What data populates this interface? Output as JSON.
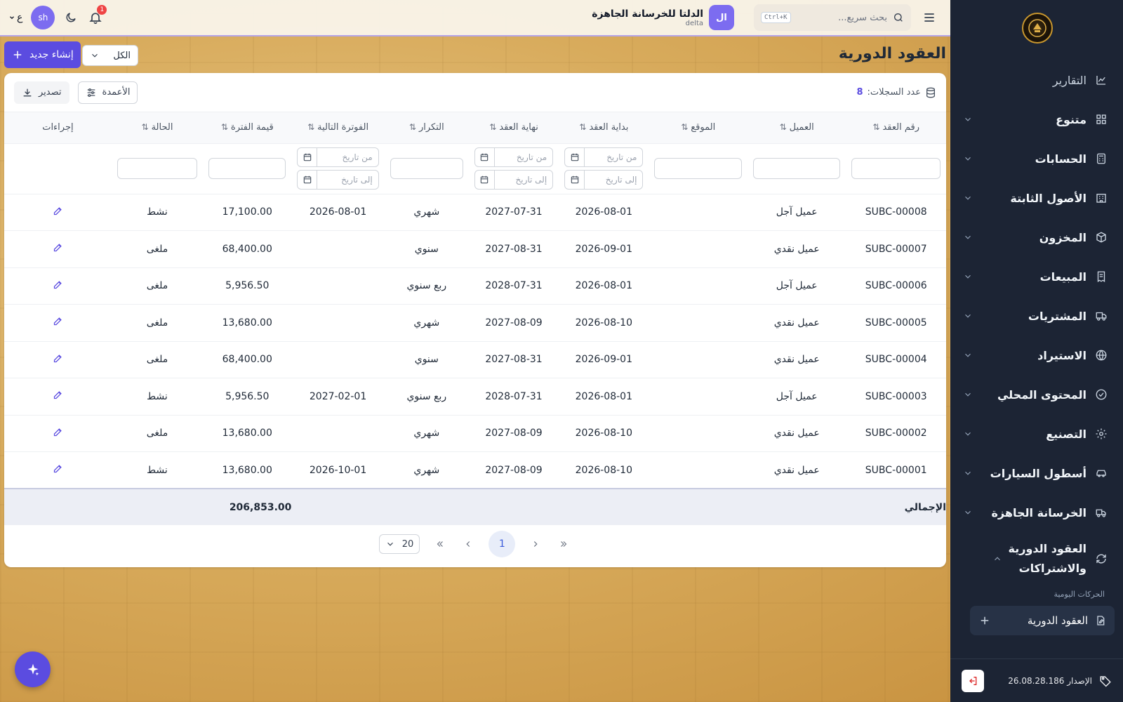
{
  "topbar": {
    "search_placeholder": "بحث سريع...",
    "search_shortcut": "Ctrl+K",
    "company_avatar": "ال",
    "company_name": "الدلتا للخرسانة الجاهزة",
    "company_sub": "delta",
    "notification_count": "1",
    "user_initials": "sh",
    "language": "ع"
  },
  "page": {
    "title": "العقود الدورية",
    "new_button": "إنشاء جديد",
    "filter_value": "الكل"
  },
  "toolbar": {
    "record_count_label": "عدد السجلات:",
    "record_count": "8",
    "columns_button": "الأعمدة",
    "export_button": "تصدير"
  },
  "table": {
    "headers": {
      "contract_no": "رقم العقد",
      "customer": "العميل",
      "site": "الموقع",
      "start": "بداية العقد",
      "end": "نهاية العقد",
      "recurrence": "التكرار",
      "next_invoice": "الفوترة التالية",
      "period_value": "قيمة الفترة",
      "status": "الحالة",
      "actions": "إجراءات"
    },
    "date_from": "من تاريخ",
    "date_to": "إلى تاريخ",
    "rows": [
      {
        "no": "SUBC-00008",
        "customer": "عميل آجل",
        "site": "",
        "start": "2026-08-01",
        "end": "2027-07-31",
        "recurrence": "شهري",
        "next": "2026-08-01",
        "value": "17,100.00",
        "status": "نشط"
      },
      {
        "no": "SUBC-00007",
        "customer": "عميل نقدي",
        "site": "",
        "start": "2026-09-01",
        "end": "2027-08-31",
        "recurrence": "سنوي",
        "next": "",
        "value": "68,400.00",
        "status": "ملغى"
      },
      {
        "no": "SUBC-00006",
        "customer": "عميل آجل",
        "site": "",
        "start": "2026-08-01",
        "end": "2028-07-31",
        "recurrence": "ربع سنوي",
        "next": "",
        "value": "5,956.50",
        "status": "ملغى"
      },
      {
        "no": "SUBC-00005",
        "customer": "عميل نقدي",
        "site": "",
        "start": "2026-08-10",
        "end": "2027-08-09",
        "recurrence": "شهري",
        "next": "",
        "value": "13,680.00",
        "status": "ملغى"
      },
      {
        "no": "SUBC-00004",
        "customer": "عميل نقدي",
        "site": "",
        "start": "2026-09-01",
        "end": "2027-08-31",
        "recurrence": "سنوي",
        "next": "",
        "value": "68,400.00",
        "status": "ملغى"
      },
      {
        "no": "SUBC-00003",
        "customer": "عميل آجل",
        "site": "",
        "start": "2026-08-01",
        "end": "2028-07-31",
        "recurrence": "ربع سنوي",
        "next": "2027-02-01",
        "value": "5,956.50",
        "status": "نشط"
      },
      {
        "no": "SUBC-00002",
        "customer": "عميل نقدي",
        "site": "",
        "start": "2026-08-10",
        "end": "2027-08-09",
        "recurrence": "شهري",
        "next": "",
        "value": "13,680.00",
        "status": "ملغى"
      },
      {
        "no": "SUBC-00001",
        "customer": "عميل نقدي",
        "site": "",
        "start": "2026-08-10",
        "end": "2027-08-09",
        "recurrence": "شهري",
        "next": "2026-10-01",
        "value": "13,680.00",
        "status": "نشط"
      }
    ],
    "total_label": "الإجمالي",
    "total_value": "206,853.00"
  },
  "pagination": {
    "current_page": "1",
    "page_size": "20"
  },
  "sidebar": {
    "items": [
      {
        "label": "التقارير",
        "icon": "chart-line-icon",
        "expandable": false
      },
      {
        "label": "متنوع",
        "icon": "grid-icon",
        "expandable": true
      },
      {
        "label": "الحسابات",
        "icon": "calculator-icon",
        "expandable": true
      },
      {
        "label": "الأصول الثابتة",
        "icon": "building-icon",
        "expandable": true
      },
      {
        "label": "المخزون",
        "icon": "box-icon",
        "expandable": true
      },
      {
        "label": "المبيعات",
        "icon": "receipt-icon",
        "expandable": true
      },
      {
        "label": "المشتريات",
        "icon": "truck-icon",
        "expandable": true
      },
      {
        "label": "الاستيراد",
        "icon": "globe-icon",
        "expandable": true
      },
      {
        "label": "المحتوى المحلي",
        "icon": "check-badge-icon",
        "expandable": true
      },
      {
        "label": "التصنيع",
        "icon": "gear-icon",
        "expandable": true
      },
      {
        "label": "أسطول السيارات",
        "icon": "car-icon",
        "expandable": true
      },
      {
        "label": "الخرسانة الجاهزة",
        "icon": "mixer-truck-icon",
        "expandable": true
      }
    ],
    "open_group": "العقود الدورية والاشتراكات",
    "section_caption": "الحركات اليومية",
    "active_item": "العقود الدورية",
    "version": "الإصدار 26.08.28.186"
  },
  "colors": {
    "accent": "#5b4ce0",
    "sidebar_bg": "#1c2434"
  }
}
